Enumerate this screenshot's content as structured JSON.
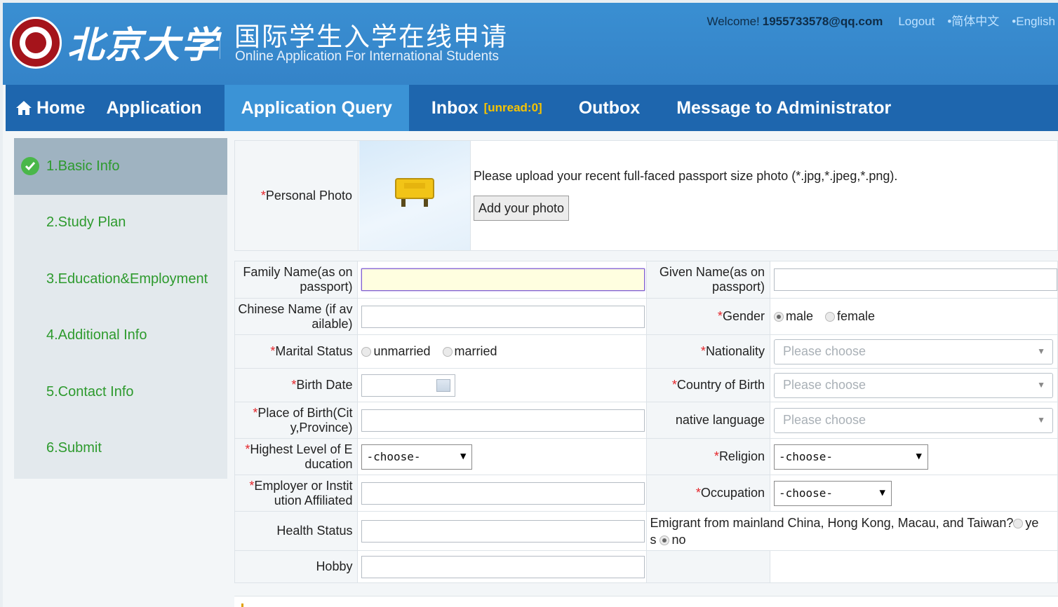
{
  "header": {
    "university_name": "北京大学",
    "system_title": "国际学生入学在线申请",
    "system_subtitle": "Online Application For International Students",
    "welcome": "Welcome!",
    "user_email": "1955733578@qq.com",
    "logout": "Logout",
    "lang_zh": "•简体中文",
    "lang_en": "•English"
  },
  "nav": {
    "home": "Home",
    "application": "Application",
    "application_query": "Application Query",
    "inbox": "Inbox",
    "inbox_unread": "[unread:0]",
    "outbox": "Outbox",
    "message_admin": "Message to Administrator"
  },
  "sidebar": {
    "items": [
      {
        "label": "1.Basic Info",
        "done": true
      },
      {
        "label": "2.Study Plan"
      },
      {
        "label": "3.Education&Employment"
      },
      {
        "label": "4.Additional Info"
      },
      {
        "label": "5.Contact Info"
      },
      {
        "label": "6.Submit"
      }
    ]
  },
  "photo": {
    "label": "Personal Photo",
    "hint": "Please upload your recent full-faced passport size photo (*.jpg,*.jpeg,*.png).",
    "button": "Add your photo"
  },
  "form": {
    "required_mark": "*",
    "family_name_label_1": "Family Name(as on",
    "family_name_label_2": "passport)",
    "given_name_label_1": "Given Name(as on",
    "given_name_label_2": "passport)",
    "chinese_name_label_1": "Chinese Name (if av",
    "chinese_name_label_2": "ailable)",
    "gender_label": "Gender",
    "gender_male": "male",
    "gender_female": "female",
    "gender_selected": "male",
    "marital_label": "Marital Status",
    "marital_unmarried": "unmarried",
    "marital_married": "married",
    "nationality_label": "Nationality",
    "nationality_placeholder": "Please choose",
    "birth_date_label": "Birth Date",
    "country_birth_label": "Country of Birth",
    "country_birth_placeholder": "Please choose",
    "place_birth_label_1": "Place of Birth(Cit",
    "place_birth_label_2": "y,Province)",
    "native_language_label": "native language",
    "native_language_placeholder": "Please choose",
    "education_label_1": "Highest Level of E",
    "education_label_2": "ducation",
    "education_value": "-choose-",
    "religion_label": "Religion",
    "religion_value": "-choose-",
    "employer_label_1": "Employer or Instit",
    "employer_label_2": "ution Affiliated",
    "occupation_label": "Occupation",
    "occupation_value": "-choose-",
    "health_label": "Health Status",
    "emigrant_text_1": "Emigrant from mainland China, Hong Kong, Macau, and Taiwan?",
    "emigrant_yes_1": "ye",
    "emigrant_yes_2": "s",
    "emigrant_no": "no",
    "emigrant_selected": "no",
    "hobby_label": "Hobby"
  }
}
